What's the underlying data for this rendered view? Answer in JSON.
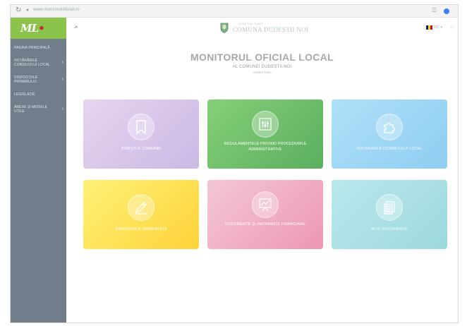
{
  "browser": {
    "url": "www.monitoruloficial.ro"
  },
  "sidebar": {
    "logo_main": "ML",
    "logo_mark": "•",
    "items": [
      {
        "label": "Pagina Principală",
        "has_chevron": false
      },
      {
        "label": "Hotărârile Consiliului Local",
        "has_chevron": true
      },
      {
        "label": "Dispozițiile Primarului",
        "has_chevron": true
      },
      {
        "label": "Legislație",
        "has_chevron": false
      },
      {
        "label": "Anexe și modele utile",
        "has_chevron": true
      }
    ],
    "chevron_glyph": "›"
  },
  "header": {
    "site_super": "JUDEȚUL TIMIȘ",
    "site_name": "COMUNA DUDEȘTII NOI",
    "lang_code": "RO",
    "lang_caret": "▾",
    "flag_colors": [
      "#002B7F",
      "#FCD116",
      "#CE1126"
    ]
  },
  "page": {
    "title": "MONITORUL OFICIAL LOCAL",
    "subtitle": "AL COMUNEI DUDEȘTII NOI",
    "meta": "Județul Timiș"
  },
  "cards": [
    {
      "label": "Statutul comunei",
      "icon": "bookmark-icon"
    },
    {
      "label": "Regulamentele privind procedurile administrative",
      "icon": "sliders-icon"
    },
    {
      "label": "Hotărârile consiliului local",
      "icon": "puzzle-icon"
    },
    {
      "label": "Dispozițiile primarului",
      "icon": "pencil-icon"
    },
    {
      "label": "Documente și informații financiare",
      "icon": "presentation-chart-icon"
    },
    {
      "label": "Alte documente",
      "icon": "documents-icon"
    }
  ],
  "colors": {
    "sidebar_bg": "#6f7e8a",
    "logo_bg": "#8bc34a",
    "accent_red": "#c62828"
  }
}
